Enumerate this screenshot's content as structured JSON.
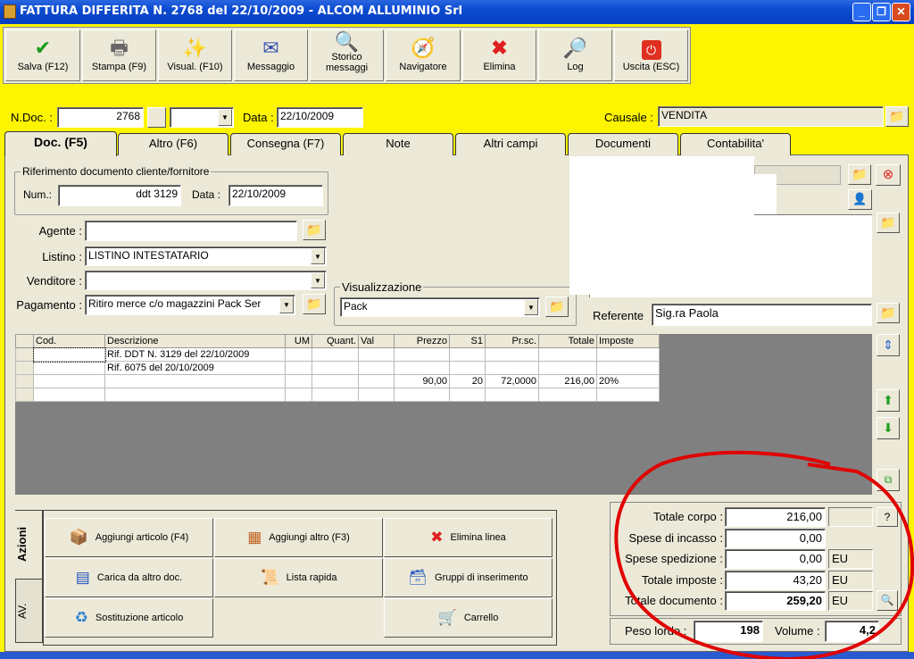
{
  "window": {
    "title": "FATTURA DIFFERITA N. 2768  del 22/10/2009 - ALCOM ALLUMINIO Srl",
    "controls": [
      "minimize",
      "restore",
      "close"
    ]
  },
  "toolbar": [
    {
      "label": "Salva (F12)",
      "icon": "check-icon"
    },
    {
      "label": "Stampa (F9)",
      "icon": "printer-icon"
    },
    {
      "label": "Visual. (F10)",
      "icon": "magic-wand-icon"
    },
    {
      "label": "Messaggio",
      "icon": "envelope-pen-icon"
    },
    {
      "label": "Storico messaggi",
      "icon": "envelope-search-icon"
    },
    {
      "label": "Navigatore",
      "icon": "compass-icon"
    },
    {
      "label": "Elimina",
      "icon": "red-x-icon"
    },
    {
      "label": "Log",
      "icon": "log-search-icon"
    },
    {
      "label": "Uscita (ESC)",
      "icon": "power-icon"
    }
  ],
  "header": {
    "ndoc_label": "N.Doc. :",
    "ndoc_value": "2768",
    "series_value": "",
    "data_label": "Data :",
    "data_value": "22/10/2009",
    "causale_label": "Causale :",
    "causale_value": "VENDITA"
  },
  "tabs": [
    "Doc. (F5)",
    "Altro (F6)",
    "Consegna (F7)",
    "Note",
    "Altri campi",
    "Documenti",
    "Contabilita'"
  ],
  "riferimento": {
    "title": "Riferimento documento cliente/fornitore",
    "num_label": "Num.:",
    "num_value": "ddt 3129",
    "data_label": "Data :",
    "data_value": "22/10/2009"
  },
  "form": {
    "agente_label": "Agente :",
    "agente_value": "",
    "listino_label": "Listino :",
    "listino_value": "LISTINO INTESTATARIO",
    "venditore_label": "Venditore :",
    "venditore_value": "",
    "pagamento_label": "Pagamento :",
    "pagamento_value": "Ritiro merce c/o magazzini Pack Ser",
    "visualizzazione_title": "Visualizzazione",
    "visualizzazione_value": "Pack",
    "referente_label": "Referente",
    "referente_value": "Sig.ra Paola"
  },
  "grid": {
    "columns": [
      "Cod.",
      "Descrizione",
      "UM",
      "Quant.",
      "Val",
      "Prezzo",
      "S1",
      "Pr.sc.",
      "Totale",
      "Imposte"
    ],
    "rows": [
      [
        "",
        "Rif. DDT N. 3129 del 22/10/2009",
        "",
        "",
        "",
        "",
        "",
        "",
        "",
        ""
      ],
      [
        "",
        "Rif. 6075 del 20/10/2009",
        "",
        "",
        "",
        "",
        "",
        "",
        "",
        ""
      ],
      [
        "",
        "",
        "",
        "",
        "",
        "90,00",
        "20",
        "72,0000",
        "216,00",
        "20%"
      ],
      [
        "",
        "",
        "",
        "",
        "",
        "",
        "",
        "",
        "",
        ""
      ]
    ]
  },
  "side_tabs": [
    "Azioni",
    "AV."
  ],
  "actions": [
    {
      "label": "Aggiungi articolo (F4)",
      "icon": "add-article-icon"
    },
    {
      "label": "Aggiungi altro (F3)",
      "icon": "add-grid-icon"
    },
    {
      "label": "Elimina linea",
      "icon": "delete-icon"
    },
    {
      "label": "Carica da altro doc.",
      "icon": "load-doc-icon"
    },
    {
      "label": "Lista rapida",
      "icon": "quick-list-icon"
    },
    {
      "label": "Gruppi di inserimento",
      "icon": "group-insert-icon"
    },
    {
      "label": "Sostituzione articolo",
      "icon": "replace-icon"
    },
    {
      "label": "",
      "icon": ""
    },
    {
      "label": "Carrello",
      "icon": "cart-icon"
    }
  ],
  "totals": [
    {
      "label": "Totale corpo :",
      "value": "216,00",
      "unit": ""
    },
    {
      "label": "Spese di incasso :",
      "value": "0,00",
      "unit": null
    },
    {
      "label": "Spese spedizione :",
      "value": "0,00",
      "unit": "EU"
    },
    {
      "label": "Totale imposte :",
      "value": "43,20",
      "unit": "EU"
    },
    {
      "label": "Totale documento :",
      "value": "259,20",
      "unit": "EU"
    }
  ],
  "help_label": "?",
  "peso": {
    "label": "Peso lordo :",
    "value": "198",
    "volume_label": "Volume :",
    "volume_value": "4,2"
  },
  "colors": {
    "background": "#fcf400",
    "panel": "#ece9d8",
    "annotation": "#e00000",
    "grid_bg": "#808080"
  }
}
